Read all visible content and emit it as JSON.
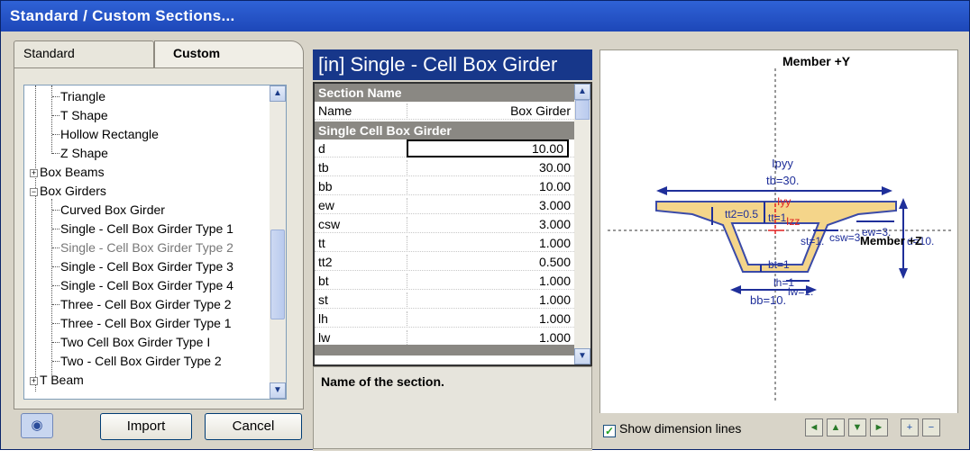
{
  "window": {
    "title": "Standard / Custom Sections..."
  },
  "tabs": {
    "standard": "Standard",
    "custom": "Custom"
  },
  "tree": {
    "items": [
      {
        "label": "Triangle",
        "expander": ""
      },
      {
        "label": "T Shape",
        "expander": ""
      },
      {
        "label": "Hollow Rectangle",
        "expander": ""
      },
      {
        "label": "Z Shape",
        "expander": ""
      },
      {
        "label": "Box Beams",
        "expander": "+"
      },
      {
        "label": "Box Girders",
        "expander": "−"
      },
      {
        "label": "Curved Box Girder",
        "expander": ""
      },
      {
        "label": "Single - Cell Box Girder Type 1",
        "expander": ""
      },
      {
        "label": "Single - Cell Box Girder Type 2",
        "expander": ""
      },
      {
        "label": "Single - Cell Box Girder Type 3",
        "expander": ""
      },
      {
        "label": "Single - Cell Box Girder Type 4",
        "expander": ""
      },
      {
        "label": "Three - Cell Box Girder Type 2",
        "expander": ""
      },
      {
        "label": "Three - Cell Box Girder Type 1",
        "expander": ""
      },
      {
        "label": "Two Cell Box Girder Type I",
        "expander": ""
      },
      {
        "label": "Two - Cell Box Girder Type 2",
        "expander": ""
      },
      {
        "label": "T Beam",
        "expander": "+"
      }
    ],
    "selected": "Single - Cell Box Girder Type 2"
  },
  "buttons": {
    "import": "Import",
    "cancel": "Cancel"
  },
  "section": {
    "title": "[in] Single - Cell Box Girder",
    "group1": "Section Name",
    "name_label": "Name",
    "name_value": "Box Girder",
    "group2": "Single Cell Box Girder",
    "params": [
      {
        "name": "d",
        "value": "10.00"
      },
      {
        "name": "tb",
        "value": "30.00"
      },
      {
        "name": "bb",
        "value": "10.00"
      },
      {
        "name": "ew",
        "value": "3.000"
      },
      {
        "name": "csw",
        "value": "3.000"
      },
      {
        "name": "tt",
        "value": "1.000"
      },
      {
        "name": "tt2",
        "value": "0.500"
      },
      {
        "name": "bt",
        "value": "1.000"
      },
      {
        "name": "st",
        "value": "1.000"
      },
      {
        "name": "lh",
        "value": "1.000"
      },
      {
        "name": "lw",
        "value": "1.000"
      }
    ],
    "description": "Name of the section."
  },
  "preview": {
    "member_y": "Member +Y",
    "member_z": "Member +Z",
    "labels": {
      "ipyy": "Ipyy",
      "tb": "tb=30.",
      "tt2": "tt2=0.5",
      "tt": "tt=1",
      "izz": "Izz",
      "iyy": "Iyy",
      "st": "st=1.",
      "csw": "csw=3.",
      "ew": "ew=3.",
      "d": "d=10.",
      "bt": "bt=1",
      "lh": "lh=1",
      "lw": "lw=1.",
      "bb": "bb=10."
    },
    "show_dimension_lines": "Show dimension lines",
    "colors": {
      "section_fill": "#f4d58a",
      "section_outline": "#3a4aa8",
      "dim": "#1f2f9a",
      "red": "#e02020"
    }
  }
}
